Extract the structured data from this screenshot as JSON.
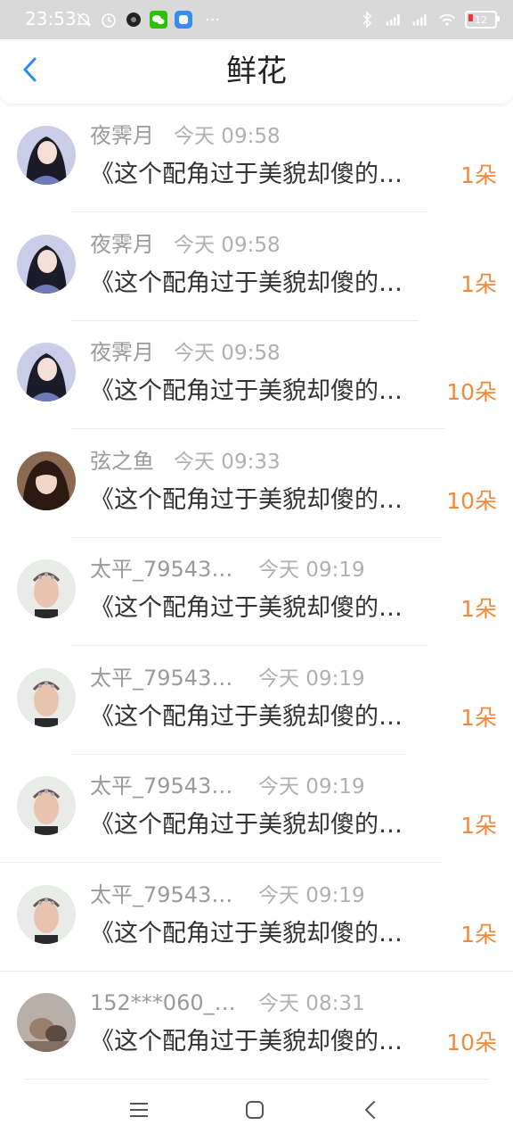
{
  "status_bar": {
    "time": "23:53",
    "battery": "12",
    "more": "···",
    "icons": [
      "mute-bell-icon",
      "alarm-icon",
      "record-icon",
      "wechat-icon",
      "app-icon",
      "bluetooth-icon",
      "signal-hd-1-icon",
      "signal-hd-2-icon",
      "wifi-icon",
      "battery-icon"
    ]
  },
  "header": {
    "title": "鲜花",
    "back_icon": "chevron-left-icon"
  },
  "colors": {
    "accent": "#2d8cf0",
    "count": "#ef8a3c",
    "name": "#9a9a9a",
    "time": "#b0b0b0"
  },
  "items": [
    {
      "name": "夜霁月",
      "time": "今天 09:58",
      "message": "《这个配角过于美貌却傻的…",
      "count": "1朵"
    },
    {
      "name": "夜霁月",
      "time": "今天 09:58",
      "message": "《这个配角过于美貌却傻的…",
      "count": "1朵"
    },
    {
      "name": "夜霁月",
      "time": "今天 09:58",
      "message": "《这个配角过于美貌却傻的…",
      "count": "10朵"
    },
    {
      "name": "弦之鱼",
      "time": "今天 09:33",
      "message": "《这个配角过于美貌却傻的…",
      "count": "10朵"
    },
    {
      "name": "太平_79543…",
      "time": "今天 09:19",
      "message": "《这个配角过于美貌却傻的…",
      "count": "1朵"
    },
    {
      "name": "太平_79543…",
      "time": "今天 09:19",
      "message": "《这个配角过于美貌却傻的…",
      "count": "1朵"
    },
    {
      "name": "太平_79543…",
      "time": "今天 09:19",
      "message": "《这个配角过于美貌却傻的…",
      "count": "1朵"
    },
    {
      "name": "太平_79543…",
      "time": "今天 09:19",
      "message": "《这个配角过于美貌却傻的…",
      "count": "1朵"
    },
    {
      "name": "152***060_…",
      "time": "今天 08:31",
      "message": "《这个配角过于美貌却傻的…",
      "count": "10朵"
    }
  ],
  "nav": {
    "menu_icon": "menu-icon",
    "home_icon": "home-icon",
    "back_icon": "back-icon"
  }
}
